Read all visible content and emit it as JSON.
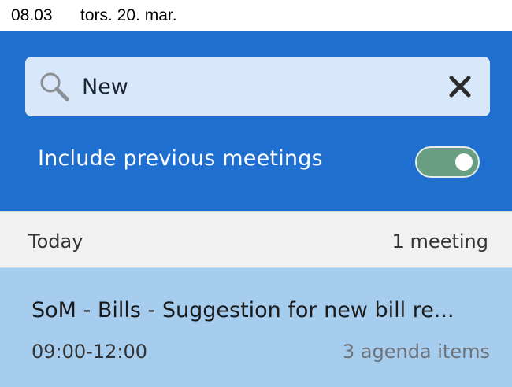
{
  "status_bar": {
    "time": "08.03",
    "date": "tors. 20. mar."
  },
  "search": {
    "value": "New",
    "icon": "search-icon",
    "clear_icon": "close-icon"
  },
  "filter": {
    "include_previous_label": "Include previous meetings",
    "include_previous_on": true
  },
  "section": {
    "title": "Today",
    "count": "1 meeting"
  },
  "meetings": [
    {
      "title": "SoM - Bills - Suggestion for new bill re...",
      "time": "09:00-12:00",
      "agenda": "3 agenda items"
    }
  ],
  "colors": {
    "header_bg": "#1f6fd0",
    "search_bg": "#d8e8fa",
    "toggle_on": "#6a9e83",
    "section_bg": "#f1f1f1",
    "selected_item_bg": "#a7cdee"
  }
}
